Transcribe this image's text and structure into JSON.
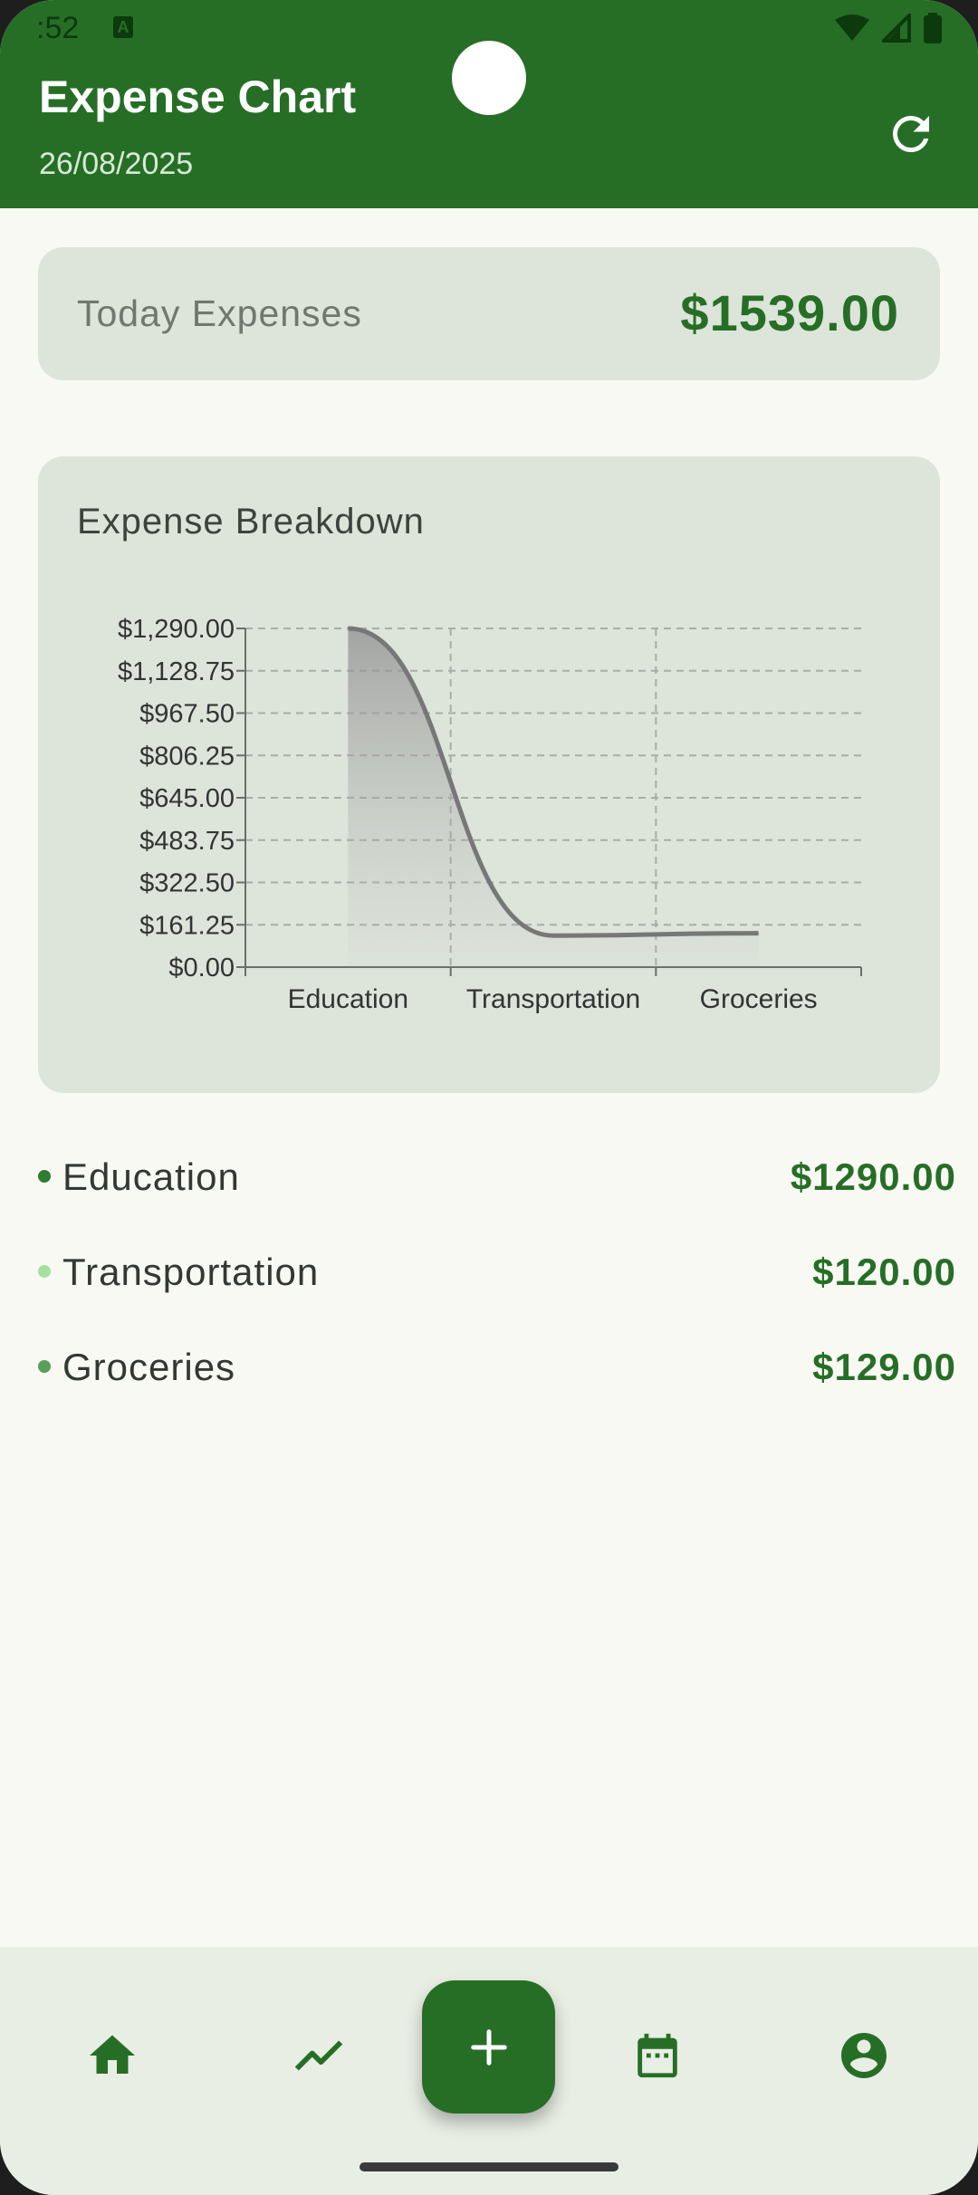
{
  "status_bar": {
    "time": ":52",
    "notification_icon": "A"
  },
  "header": {
    "title": "Expense Chart",
    "date": "26/08/2025",
    "refresh_icon": "refresh-icon"
  },
  "today": {
    "label": "Today Expenses",
    "amount": "$1539.00"
  },
  "breakdown": {
    "title": "Expense Breakdown"
  },
  "chart_data": {
    "type": "area",
    "title": "Expense Breakdown",
    "categories": [
      "Education",
      "Transportation",
      "Groceries"
    ],
    "series": [
      {
        "values": [
          1290,
          120,
          129
        ]
      }
    ],
    "y_ticks": [
      "$0.00",
      "$161.25",
      "$322.50",
      "$483.75",
      "$645.00",
      "$806.25",
      "$967.50",
      "$1,128.75",
      "$1,290.00"
    ],
    "ylim": [
      0,
      1290
    ],
    "grid": true,
    "line_color": "#777777"
  },
  "legend": [
    {
      "name": "Education",
      "value": "$1290.00",
      "color": "#2e7d32"
    },
    {
      "name": "Transportation",
      "value": "$120.00",
      "color": "#a5e0a0"
    },
    {
      "name": "Groceries",
      "value": "$129.00",
      "color": "#5b9d5b"
    }
  ],
  "nav": {
    "items": [
      {
        "icon": "home-icon"
      },
      {
        "icon": "trending-icon"
      },
      {
        "icon": "add-icon"
      },
      {
        "icon": "calendar-icon"
      },
      {
        "icon": "account-icon"
      }
    ]
  },
  "colors": {
    "primary": "#266e26",
    "background": "#f9f9f4",
    "card": "#dde4da"
  }
}
